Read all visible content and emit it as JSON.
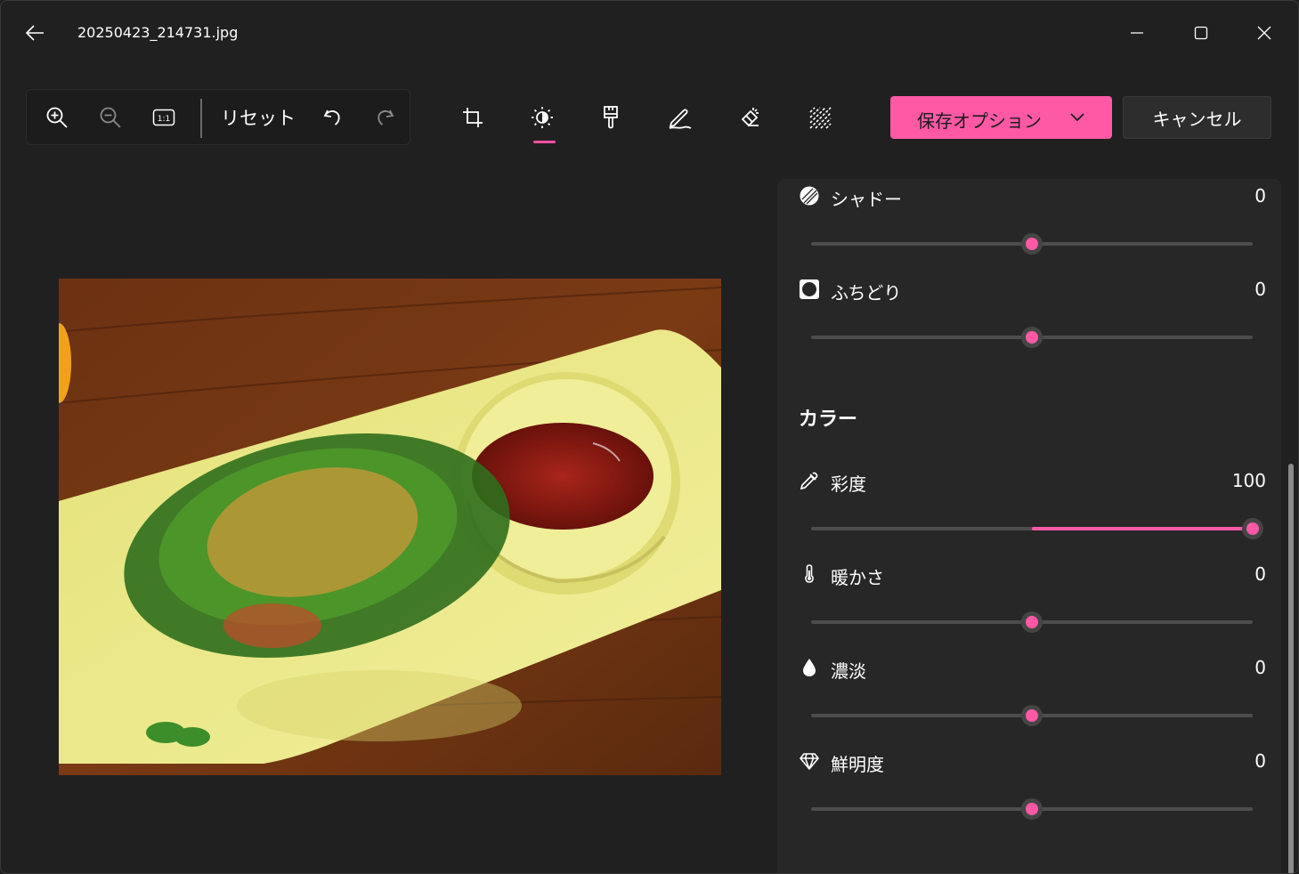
{
  "titlebar": {
    "title": "20250423_214731.jpg"
  },
  "toolbar": {
    "reset_label": "リセット",
    "tools": [
      {
        "name": "zoom-in-icon"
      },
      {
        "name": "zoom-out-icon"
      },
      {
        "name": "actual-size-icon",
        "label": "1:1"
      }
    ],
    "modes": [
      {
        "name": "crop-icon"
      },
      {
        "name": "adjust-brightness-icon",
        "selected": true
      },
      {
        "name": "filter-brush-icon"
      },
      {
        "name": "markup-pen-icon"
      },
      {
        "name": "erase-icon"
      },
      {
        "name": "background-blur-icon"
      }
    ],
    "save_label": "保存オプション",
    "cancel_label": "キャンセル"
  },
  "panel": {
    "adjustments": [
      {
        "label": "シャドー",
        "value": "0",
        "level": 0,
        "icon": "shadow-icon"
      },
      {
        "label": "ふちどり",
        "value": "0",
        "level": 0,
        "icon": "vignette-icon"
      }
    ],
    "color_section_title": "カラー",
    "color_adjustments": [
      {
        "label": "彩度",
        "value": "100",
        "level": 100,
        "icon": "eyedropper-icon"
      },
      {
        "label": "暖かさ",
        "value": "0",
        "level": 0,
        "icon": "thermometer-icon"
      },
      {
        "label": "濃淡",
        "value": "0",
        "level": 0,
        "icon": "droplet-icon"
      },
      {
        "label": "鮮明度",
        "value": "0",
        "level": 0,
        "icon": "diamond-icon"
      }
    ]
  },
  "colors": {
    "accent": "#ff59a5",
    "background": "#202020",
    "panel": "#272727"
  }
}
